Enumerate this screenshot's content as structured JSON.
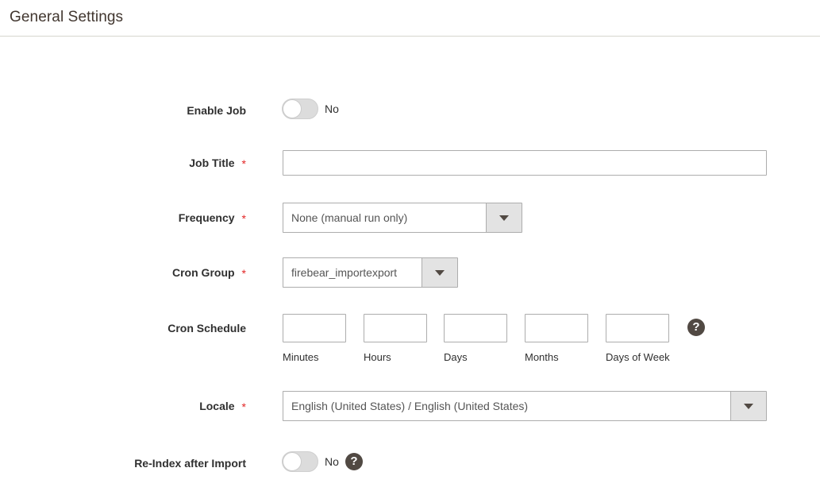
{
  "section": {
    "title": "General Settings"
  },
  "fields": {
    "enable_job": {
      "label": "Enable Job",
      "toggle_state_text": "No",
      "toggle_on": false
    },
    "job_title": {
      "label": "Job Title",
      "required_marker": "*",
      "value": "",
      "placeholder": ""
    },
    "frequency": {
      "label": "Frequency",
      "required_marker": "*",
      "value": "None (manual run only)"
    },
    "cron_group": {
      "label": "Cron Group",
      "required_marker": "*",
      "value": "firebear_importexport"
    },
    "cron_schedule": {
      "label": "Cron Schedule",
      "help_glyph": "?",
      "inputs": [
        {
          "sub_label": "Minutes",
          "value": ""
        },
        {
          "sub_label": "Hours",
          "value": ""
        },
        {
          "sub_label": "Days",
          "value": ""
        },
        {
          "sub_label": "Months",
          "value": ""
        },
        {
          "sub_label": "Days of Week",
          "value": ""
        }
      ]
    },
    "locale": {
      "label": "Locale",
      "required_marker": "*",
      "value": "English (United States) / English (United States)"
    },
    "reindex_after_import": {
      "label": "Re-Index after Import",
      "toggle_state_text": "No",
      "toggle_on": false,
      "help_glyph": "?"
    }
  },
  "colors": {
    "title_text": "#41362f",
    "label_text": "#303030",
    "required_star": "#e22626",
    "input_border": "#adadad",
    "divider": "#d6d6cf",
    "help_icon_bg": "#514943",
    "select_button_bg": "#e3e3e3",
    "toggle_track": "#dcdcdc"
  }
}
